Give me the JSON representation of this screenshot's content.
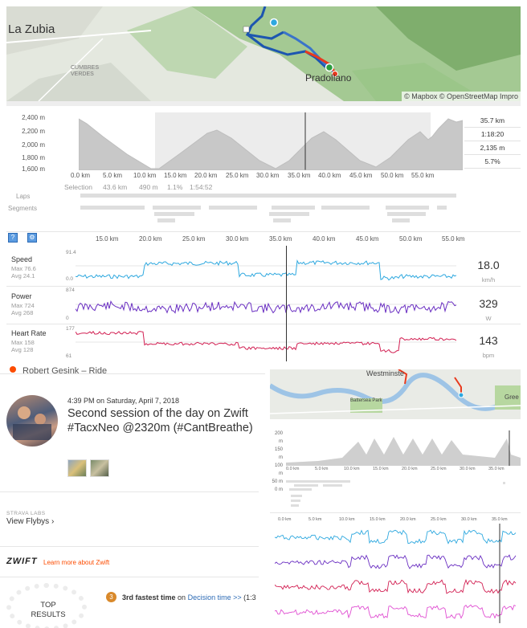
{
  "map_top": {
    "labels": [
      "La Zubia",
      "Pradollano",
      "CUMBRES VERDES"
    ],
    "attribution": "© Mapbox © OpenStreetMap Impro"
  },
  "elevation": {
    "y_ticks": [
      "2,400 m",
      "2,200 m",
      "2,000 m",
      "1,800 m",
      "1,600 m"
    ],
    "x_ticks": [
      "0.0 km",
      "5.0 km",
      "10.0 km",
      "15.0 km",
      "20.0 km",
      "25.0 km",
      "30.0 km",
      "35.0 km",
      "40.0 km",
      "45.0 km",
      "50.0 km",
      "55.0 km"
    ],
    "stats": [
      "35.7 km",
      "1:18:20",
      "2,135 m",
      "5.7%"
    ],
    "selection": {
      "label": "Selection",
      "distance": "43.6 km",
      "elevation": "490 m",
      "grade": "1.1%",
      "time": "1:54:52"
    },
    "laps_label": "Laps",
    "segments_label": "Segments"
  },
  "streams": {
    "x_ticks": [
      "15.0 km",
      "20.0 km",
      "25.0 km",
      "30.0 km",
      "35.0 km",
      "40.0 km",
      "45.0 km",
      "50.0 km",
      "55.0 km"
    ],
    "panels": [
      {
        "title": "Speed",
        "max": "Max 76.6",
        "avg": "Avg 24.1",
        "top": "91.4",
        "bottom": "0.0",
        "value": "18.0",
        "unit": "km/h",
        "color": "#2ea8df"
      },
      {
        "title": "Power",
        "max": "Max 724",
        "avg": "Avg 268",
        "top": "874",
        "bottom": "0",
        "value": "329",
        "unit": "W",
        "color": "#6a2fc2"
      },
      {
        "title": "Heart Rate",
        "max": "Max 158",
        "avg": "Avg 128",
        "top": "177",
        "bottom": "61",
        "value": "143",
        "unit": "bpm",
        "color": "#d21f52"
      }
    ]
  },
  "activity": {
    "athlete_line": "Robert Gesink – Ride",
    "time": "4:39 PM",
    "date_text": "on Saturday, April 7, 2018",
    "title": "Second session of the day on Zwift #TacxNeo @2320m (#CantBreathe)",
    "strava_labs": "STRAVA LABS",
    "flybys": "View Flybys ›",
    "zwift_logo": "ZWIFT",
    "zwift_link": "Learn more about Zwift",
    "top_results": "TOP RESULTS",
    "achievement_rank": "3",
    "achievement_text": "3rd fastest time",
    "achievement_on": "on",
    "achievement_segment": "Decision time >>",
    "achievement_extra": "(1:3"
  },
  "embed": {
    "map_labels": [
      "Westminste",
      "Battersea Park",
      "Gree"
    ],
    "y_ticks": [
      "200 m",
      "150 m",
      "100 m",
      "50 m",
      "0 m"
    ],
    "x_ticks": [
      "0.0 km",
      "5.0 km",
      "10.0 km",
      "15.0 km",
      "20.0 km",
      "25.0 km",
      "30.0 km",
      "35.0 km"
    ],
    "stream_x_ticks": [
      "0.0 km",
      "5.0 km",
      "10.0 km",
      "15.0 km",
      "20.0 km",
      "25.0 km",
      "30.0 km",
      "35.0 km"
    ]
  }
}
